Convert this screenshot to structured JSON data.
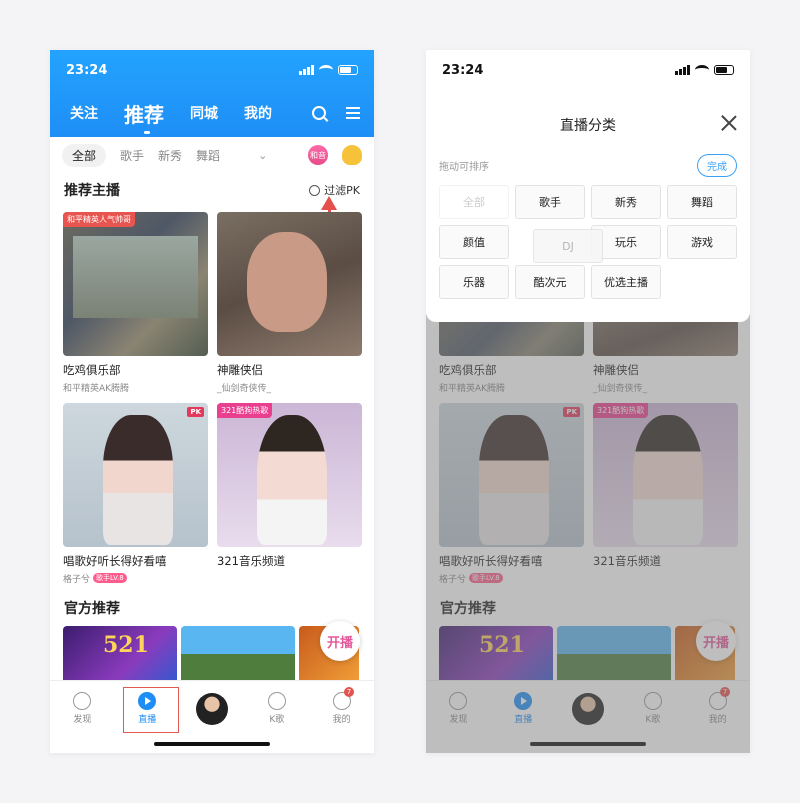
{
  "status_time": "23:24",
  "home": {
    "top_tabs": [
      "关注",
      "推荐",
      "同城",
      "我的"
    ],
    "categories": [
      "全部",
      "歌手",
      "新秀",
      "舞蹈"
    ],
    "badge_text": "和音",
    "section1_title": "推荐主播",
    "pk_filter_label": "过滤PK",
    "cards": [
      {
        "tag": "和平精英人气帅哥",
        "title": "吃鸡俱乐部",
        "sub": "和平精英AK腾腾"
      },
      {
        "tag": "",
        "title": "神雕侠侣",
        "sub": "_仙剑奇侠传_"
      },
      {
        "tag": "PK",
        "title": "唱歌好听长得好看嘻",
        "sub": "格子兮",
        "level": "歌手LV.8"
      },
      {
        "tag": "321酷狗热歌",
        "title": "321音乐频道",
        "sub": ""
      }
    ],
    "section2_title": "官方推荐",
    "official_banner_text": "521",
    "fab_text": "开播"
  },
  "tabs": [
    {
      "label": "发现"
    },
    {
      "label": "直播"
    },
    {
      "label": ""
    },
    {
      "label": "K歌"
    },
    {
      "label": "我的",
      "badge": "7"
    }
  ],
  "overlay": {
    "title": "直播分类",
    "hint": "拖动可排序",
    "done_label": "完成",
    "chips": [
      "全部",
      "歌手",
      "新秀",
      "舞蹈",
      "颜值",
      "DJ",
      "玩乐",
      "游戏",
      "乐器",
      "酷次元",
      "优选主播"
    ]
  },
  "colors": {
    "accent": "#1e8ef6",
    "highlight": "#e05a52"
  }
}
